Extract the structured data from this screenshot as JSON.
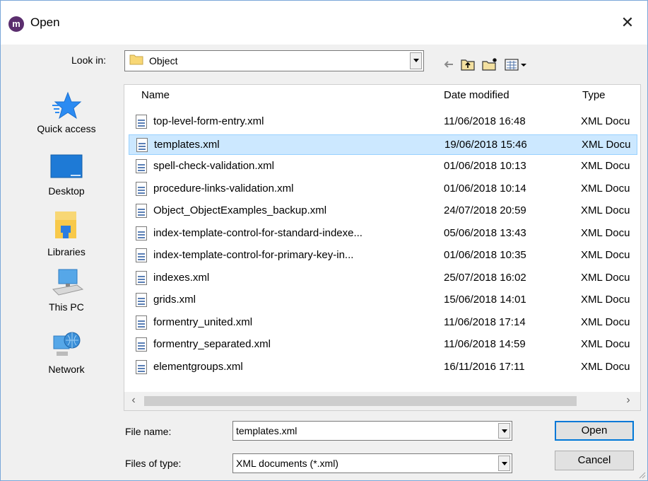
{
  "window": {
    "title": "Open",
    "logo_letter": "m",
    "close_glyph": "✕"
  },
  "toolbar": {
    "look_in_label": "Look in:",
    "look_in_value": "Object",
    "icons": [
      "back-arrow-icon",
      "up-folder-icon",
      "new-folder-icon",
      "view-menu-icon"
    ]
  },
  "places": [
    {
      "label": "Quick access",
      "icon": "star-icon"
    },
    {
      "label": "Desktop",
      "icon": "desktop-icon"
    },
    {
      "label": "Libraries",
      "icon": "libraries-icon"
    },
    {
      "label": "This PC",
      "icon": "computer-icon"
    },
    {
      "label": "Network",
      "icon": "network-icon"
    }
  ],
  "columns": {
    "name": "Name",
    "date": "Date modified",
    "type": "Type"
  },
  "files": [
    {
      "name": "top-level-form-entry.xml",
      "date": "11/06/2018 16:48",
      "type": "XML Docu",
      "selected": false
    },
    {
      "name": "templates.xml",
      "date": "19/06/2018 15:46",
      "type": "XML Docu",
      "selected": true
    },
    {
      "name": "spell-check-validation.xml",
      "date": "01/06/2018 10:13",
      "type": "XML Docu",
      "selected": false
    },
    {
      "name": "procedure-links-validation.xml",
      "date": "01/06/2018 10:14",
      "type": "XML Docu",
      "selected": false
    },
    {
      "name": "Object_ObjectExamples_backup.xml",
      "date": "24/07/2018 20:59",
      "type": "XML Docu",
      "selected": false
    },
    {
      "name": "index-template-control-for-standard-indexe...",
      "date": "05/06/2018 13:43",
      "type": "XML Docu",
      "selected": false
    },
    {
      "name": "index-template-control-for-primary-key-in...",
      "date": "01/06/2018 10:35",
      "type": "XML Docu",
      "selected": false
    },
    {
      "name": "indexes.xml",
      "date": "25/07/2018 16:02",
      "type": "XML Docu",
      "selected": false
    },
    {
      "name": "grids.xml",
      "date": "15/06/2018 14:01",
      "type": "XML Docu",
      "selected": false
    },
    {
      "name": "formentry_united.xml",
      "date": "11/06/2018 17:14",
      "type": "XML Docu",
      "selected": false
    },
    {
      "name": "formentry_separated.xml",
      "date": "11/06/2018 14:59",
      "type": "XML Docu",
      "selected": false
    },
    {
      "name": "elementgroups.xml",
      "date": "16/11/2016 17:11",
      "type": "XML Docu",
      "selected": false
    }
  ],
  "footer": {
    "file_name_label": "File name:",
    "file_name_value": "templates.xml",
    "file_type_label": "Files of type:",
    "file_type_value": "XML documents (*.xml)",
    "open_label": "Open",
    "cancel_label": "Cancel"
  },
  "colors": {
    "selection": "#cce8ff",
    "selection_border": "#99d1ff",
    "accent": "#0078d7"
  }
}
